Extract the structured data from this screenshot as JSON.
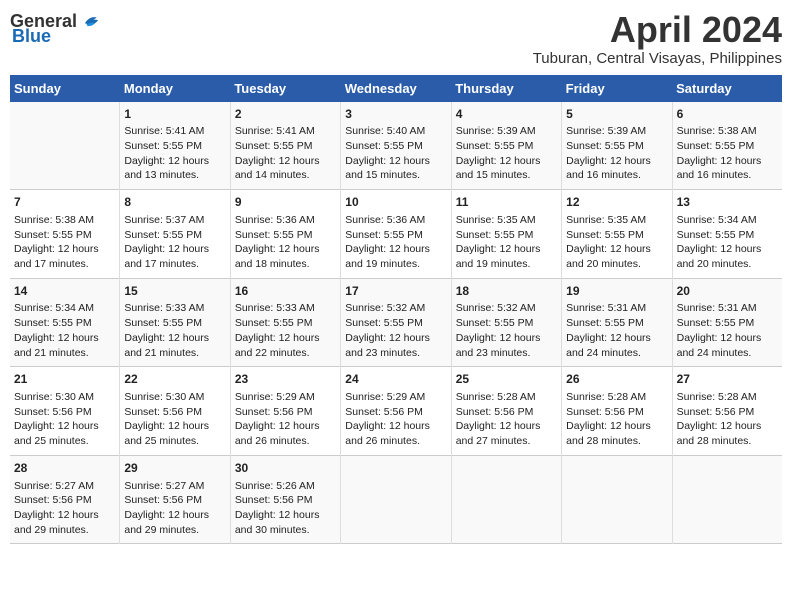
{
  "header": {
    "logo_general": "General",
    "logo_blue": "Blue",
    "month": "April 2024",
    "location": "Tuburan, Central Visayas, Philippines"
  },
  "days_of_week": [
    "Sunday",
    "Monday",
    "Tuesday",
    "Wednesday",
    "Thursday",
    "Friday",
    "Saturday"
  ],
  "weeks": [
    {
      "cells": [
        {
          "day": "",
          "content": ""
        },
        {
          "day": "1",
          "content": "Sunrise: 5:41 AM\nSunset: 5:55 PM\nDaylight: 12 hours\nand 13 minutes."
        },
        {
          "day": "2",
          "content": "Sunrise: 5:41 AM\nSunset: 5:55 PM\nDaylight: 12 hours\nand 14 minutes."
        },
        {
          "day": "3",
          "content": "Sunrise: 5:40 AM\nSunset: 5:55 PM\nDaylight: 12 hours\nand 15 minutes."
        },
        {
          "day": "4",
          "content": "Sunrise: 5:39 AM\nSunset: 5:55 PM\nDaylight: 12 hours\nand 15 minutes."
        },
        {
          "day": "5",
          "content": "Sunrise: 5:39 AM\nSunset: 5:55 PM\nDaylight: 12 hours\nand 16 minutes."
        },
        {
          "day": "6",
          "content": "Sunrise: 5:38 AM\nSunset: 5:55 PM\nDaylight: 12 hours\nand 16 minutes."
        }
      ]
    },
    {
      "cells": [
        {
          "day": "7",
          "content": "Sunrise: 5:38 AM\nSunset: 5:55 PM\nDaylight: 12 hours\nand 17 minutes."
        },
        {
          "day": "8",
          "content": "Sunrise: 5:37 AM\nSunset: 5:55 PM\nDaylight: 12 hours\nand 17 minutes."
        },
        {
          "day": "9",
          "content": "Sunrise: 5:36 AM\nSunset: 5:55 PM\nDaylight: 12 hours\nand 18 minutes."
        },
        {
          "day": "10",
          "content": "Sunrise: 5:36 AM\nSunset: 5:55 PM\nDaylight: 12 hours\nand 19 minutes."
        },
        {
          "day": "11",
          "content": "Sunrise: 5:35 AM\nSunset: 5:55 PM\nDaylight: 12 hours\nand 19 minutes."
        },
        {
          "day": "12",
          "content": "Sunrise: 5:35 AM\nSunset: 5:55 PM\nDaylight: 12 hours\nand 20 minutes."
        },
        {
          "day": "13",
          "content": "Sunrise: 5:34 AM\nSunset: 5:55 PM\nDaylight: 12 hours\nand 20 minutes."
        }
      ]
    },
    {
      "cells": [
        {
          "day": "14",
          "content": "Sunrise: 5:34 AM\nSunset: 5:55 PM\nDaylight: 12 hours\nand 21 minutes."
        },
        {
          "day": "15",
          "content": "Sunrise: 5:33 AM\nSunset: 5:55 PM\nDaylight: 12 hours\nand 21 minutes."
        },
        {
          "day": "16",
          "content": "Sunrise: 5:33 AM\nSunset: 5:55 PM\nDaylight: 12 hours\nand 22 minutes."
        },
        {
          "day": "17",
          "content": "Sunrise: 5:32 AM\nSunset: 5:55 PM\nDaylight: 12 hours\nand 23 minutes."
        },
        {
          "day": "18",
          "content": "Sunrise: 5:32 AM\nSunset: 5:55 PM\nDaylight: 12 hours\nand 23 minutes."
        },
        {
          "day": "19",
          "content": "Sunrise: 5:31 AM\nSunset: 5:55 PM\nDaylight: 12 hours\nand 24 minutes."
        },
        {
          "day": "20",
          "content": "Sunrise: 5:31 AM\nSunset: 5:55 PM\nDaylight: 12 hours\nand 24 minutes."
        }
      ]
    },
    {
      "cells": [
        {
          "day": "21",
          "content": "Sunrise: 5:30 AM\nSunset: 5:56 PM\nDaylight: 12 hours\nand 25 minutes."
        },
        {
          "day": "22",
          "content": "Sunrise: 5:30 AM\nSunset: 5:56 PM\nDaylight: 12 hours\nand 25 minutes."
        },
        {
          "day": "23",
          "content": "Sunrise: 5:29 AM\nSunset: 5:56 PM\nDaylight: 12 hours\nand 26 minutes."
        },
        {
          "day": "24",
          "content": "Sunrise: 5:29 AM\nSunset: 5:56 PM\nDaylight: 12 hours\nand 26 minutes."
        },
        {
          "day": "25",
          "content": "Sunrise: 5:28 AM\nSunset: 5:56 PM\nDaylight: 12 hours\nand 27 minutes."
        },
        {
          "day": "26",
          "content": "Sunrise: 5:28 AM\nSunset: 5:56 PM\nDaylight: 12 hours\nand 28 minutes."
        },
        {
          "day": "27",
          "content": "Sunrise: 5:28 AM\nSunset: 5:56 PM\nDaylight: 12 hours\nand 28 minutes."
        }
      ]
    },
    {
      "cells": [
        {
          "day": "28",
          "content": "Sunrise: 5:27 AM\nSunset: 5:56 PM\nDaylight: 12 hours\nand 29 minutes."
        },
        {
          "day": "29",
          "content": "Sunrise: 5:27 AM\nSunset: 5:56 PM\nDaylight: 12 hours\nand 29 minutes."
        },
        {
          "day": "30",
          "content": "Sunrise: 5:26 AM\nSunset: 5:56 PM\nDaylight: 12 hours\nand 30 minutes."
        },
        {
          "day": "",
          "content": ""
        },
        {
          "day": "",
          "content": ""
        },
        {
          "day": "",
          "content": ""
        },
        {
          "day": "",
          "content": ""
        }
      ]
    }
  ]
}
